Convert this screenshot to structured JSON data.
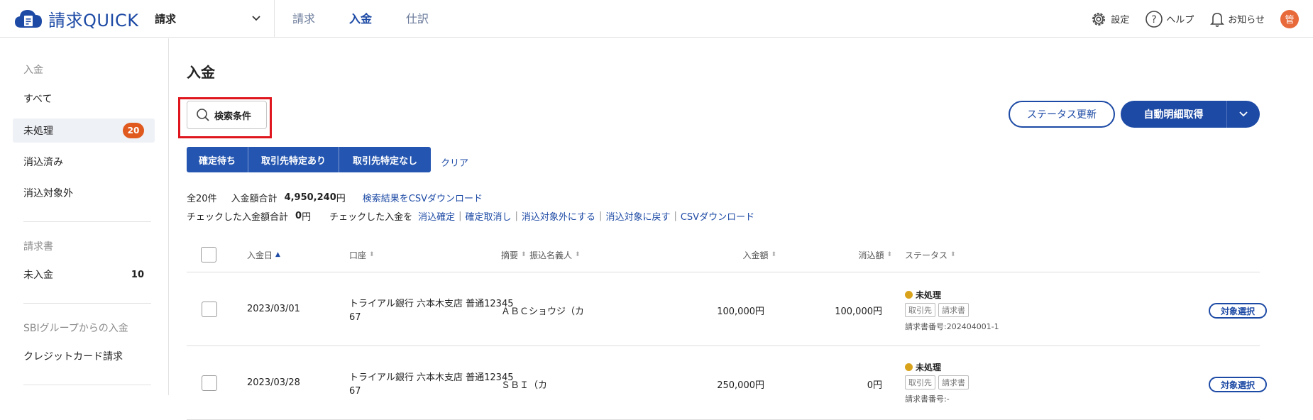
{
  "header": {
    "logo_text": "請求QUICK",
    "app_select": "請求",
    "nav": [
      {
        "label": "請求"
      },
      {
        "label": "入金"
      },
      {
        "label": "仕訳"
      }
    ],
    "settings": "設定",
    "help": "ヘルプ",
    "notifications": "お知らせ",
    "avatar": "管"
  },
  "sidebar": {
    "group1_heading": "入金",
    "items1": [
      {
        "label": "すべて"
      },
      {
        "label": "未処理",
        "badge": "20"
      },
      {
        "label": "消込済み"
      },
      {
        "label": "消込対象外"
      }
    ],
    "group2_heading": "請求書",
    "items2": [
      {
        "label": "未入金",
        "count": "10"
      }
    ],
    "group3_heading": "SBIグループからの入金",
    "items3": [
      {
        "label": "クレジットカード請求"
      }
    ]
  },
  "main": {
    "title": "入金",
    "search_button": "検索条件",
    "status_update_button": "ステータス更新",
    "auto_fetch_button": "自動明細取得",
    "filters": [
      "確定待ち",
      "取引先特定あり",
      "取引先特定なし"
    ],
    "clear": "クリア",
    "summary": {
      "total_count": "全20件",
      "amount_label": "入金額合計",
      "amount_value": "4,950,240",
      "yen": "円",
      "csv_link": "検索結果をCSVダウンロード",
      "checked_label": "チェックした入金額合計",
      "checked_value": "0",
      "checked_yen": "円",
      "checked_action_label": "チェックした入金を",
      "actions": [
        "消込確定",
        "確定取消し",
        "消込対象外にする",
        "消込対象に戻す",
        "CSVダウンロード"
      ]
    },
    "columns": {
      "date": "入金日",
      "account": "口座",
      "summary": "摘要",
      "payer": "振込名義人",
      "amount": "入金額",
      "reconciled": "消込額",
      "status": "ステータス"
    },
    "rows": [
      {
        "date": "2023/03/01",
        "account_line1": "トライアル銀行 六本木支店 普通12345",
        "account_line2": "67",
        "payer": "ＡＢＣショウジ（カ",
        "amount": "100,000円",
        "reconciled": "100,000円",
        "status": "未処理",
        "tag1": "取引先",
        "tag2": "請求書",
        "invoice_no": "請求書番号:202404001-1",
        "select": "対象選択"
      },
      {
        "date": "2023/03/28",
        "account_line1": "トライアル銀行 六本木支店 普通12345",
        "account_line2": "67",
        "payer": "ＳＢＩ（カ",
        "amount": "250,000円",
        "reconciled": "0円",
        "status": "未処理",
        "tag1": "取引先",
        "tag2": "請求書",
        "invoice_no": "請求書番号:-",
        "select": "対象選択"
      }
    ]
  },
  "colors": {
    "brand": "#1d4aa5",
    "badge": "#e05a1f",
    "highlight": "#e0161e",
    "status_pending": "#d9a21b",
    "avatar": "#e8693a"
  }
}
